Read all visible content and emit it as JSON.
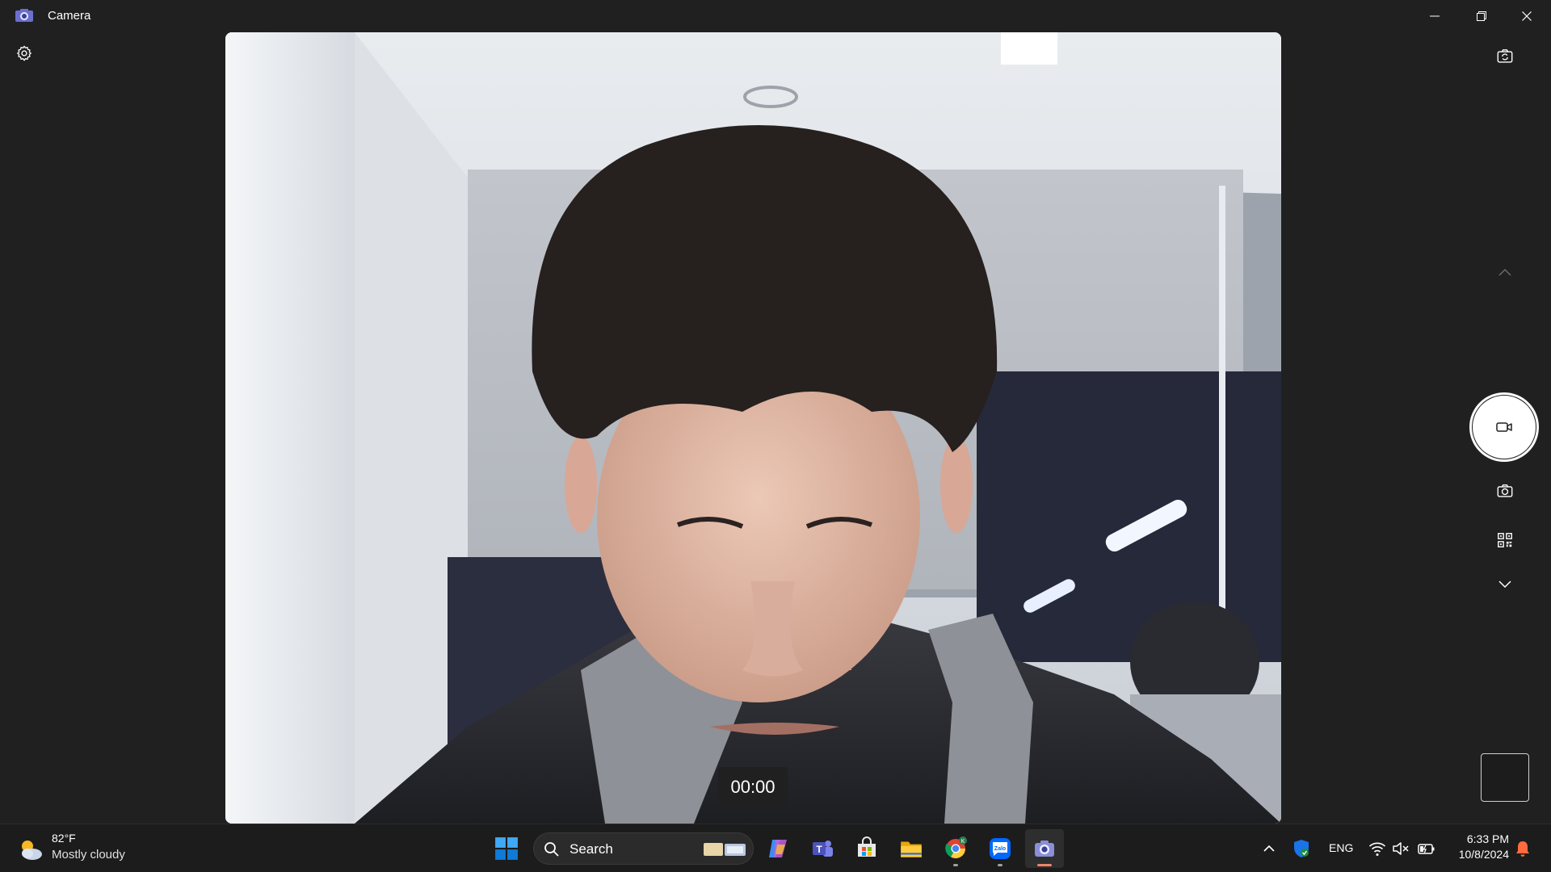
{
  "window": {
    "title": "Camera",
    "icon": "camera-app-icon",
    "controls": [
      "minimize-icon",
      "restore-icon",
      "close-icon"
    ]
  },
  "toolbar": {
    "settings_icon": "gear-icon"
  },
  "viewfinder": {
    "timer": "00:00"
  },
  "right_rail": {
    "switch_camera_icon": "switch-camera-icon",
    "scroll_up_icon": "chevron-up-icon",
    "record_icon": "video-camera-icon",
    "photo_mode_icon": "camera-icon",
    "qr_mode_icon": "qr-code-icon",
    "scroll_down_icon": "chevron-down-icon"
  },
  "taskbar": {
    "weather": {
      "temp": "82°F",
      "desc": "Mostly cloudy",
      "icon": "partly-cloudy-icon"
    },
    "search": {
      "label": "Search"
    },
    "apps": [
      "start",
      "copilot",
      "teams",
      "microsoft-store",
      "file-explorer",
      "chrome",
      "zalo",
      "camera"
    ],
    "tray": {
      "lang": "ENG",
      "time": "6:33 PM",
      "date": "10/8/2024"
    }
  },
  "colors": {
    "window_bg": "#202020",
    "taskbar_bg": "#1c1c1c",
    "active_indicator": "#f0846a",
    "accent_blue": "#0078d4"
  }
}
